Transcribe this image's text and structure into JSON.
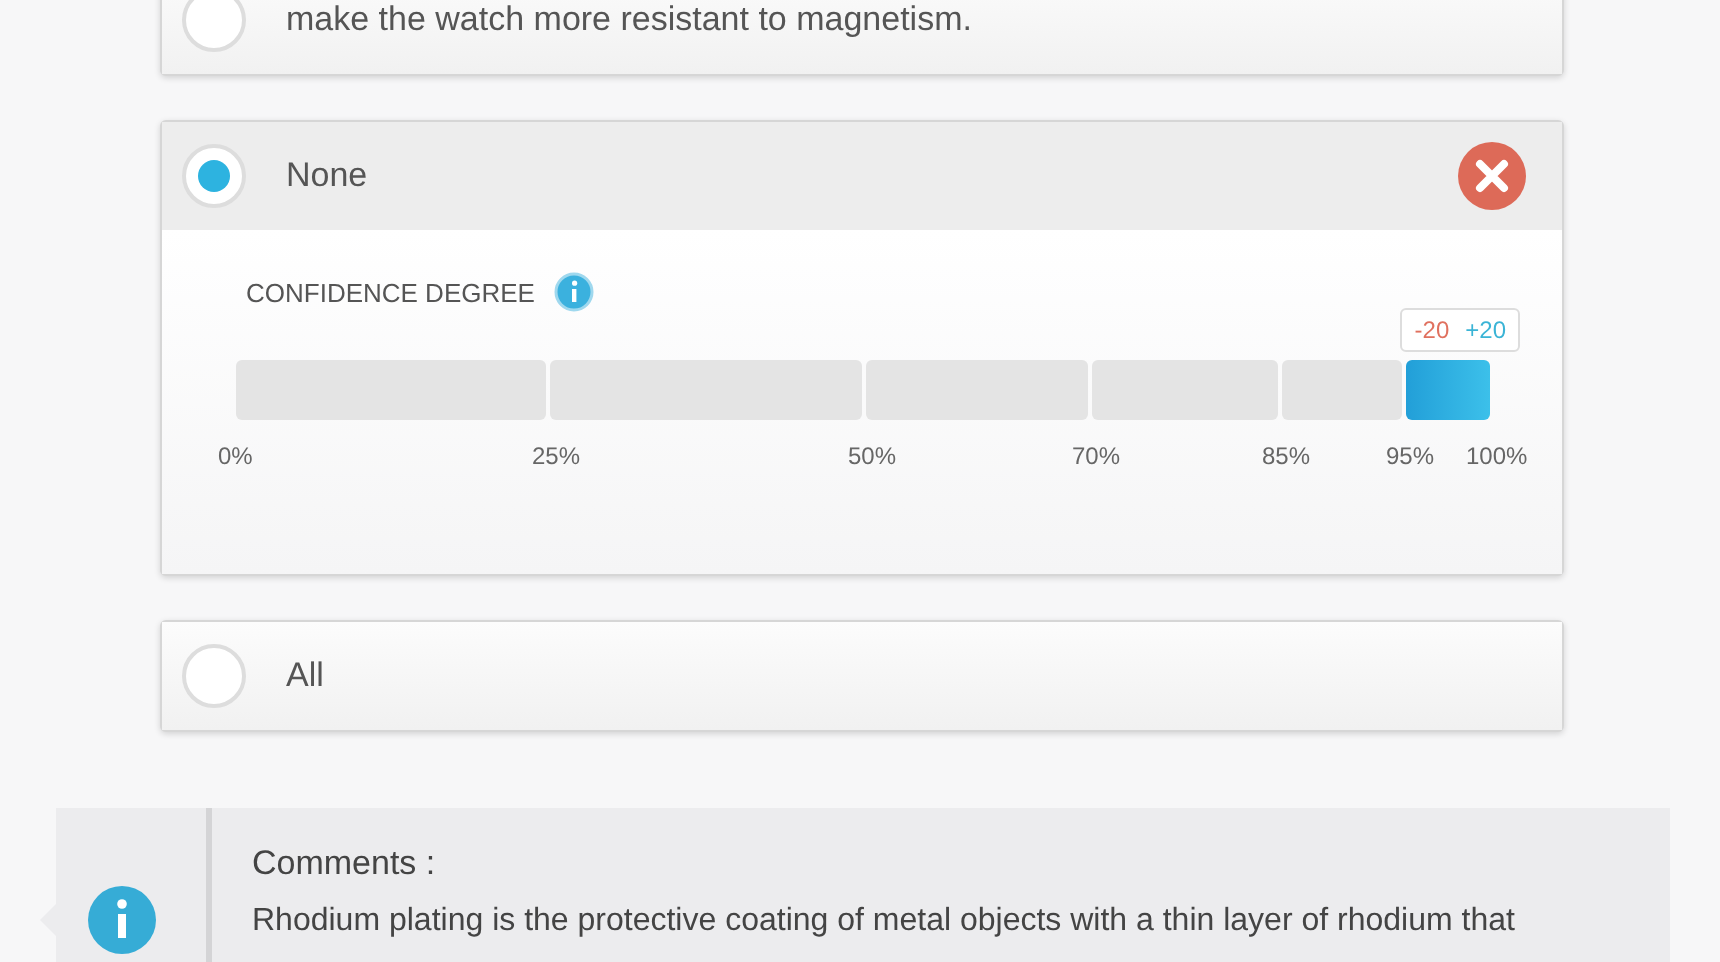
{
  "options": [
    {
      "label": "make the watch more resistant to magnetism.",
      "selected": false
    },
    {
      "label": "None",
      "selected": true,
      "confidence": {
        "title": "CONFIDENCE DEGREE",
        "minus": "-20",
        "plus": "+20",
        "segments": [
          {
            "selected": false
          },
          {
            "selected": false
          },
          {
            "selected": false
          },
          {
            "selected": false
          },
          {
            "selected": false
          },
          {
            "selected": true
          }
        ],
        "ticks": [
          "0%",
          "25%",
          "50%",
          "70%",
          "85%",
          "95%",
          "100%"
        ]
      }
    },
    {
      "label": "All",
      "selected": false
    }
  ],
  "comments": {
    "title": "Comments :",
    "text": "Rhodium plating is the protective coating of metal objects with a thin layer of rhodium that"
  }
}
